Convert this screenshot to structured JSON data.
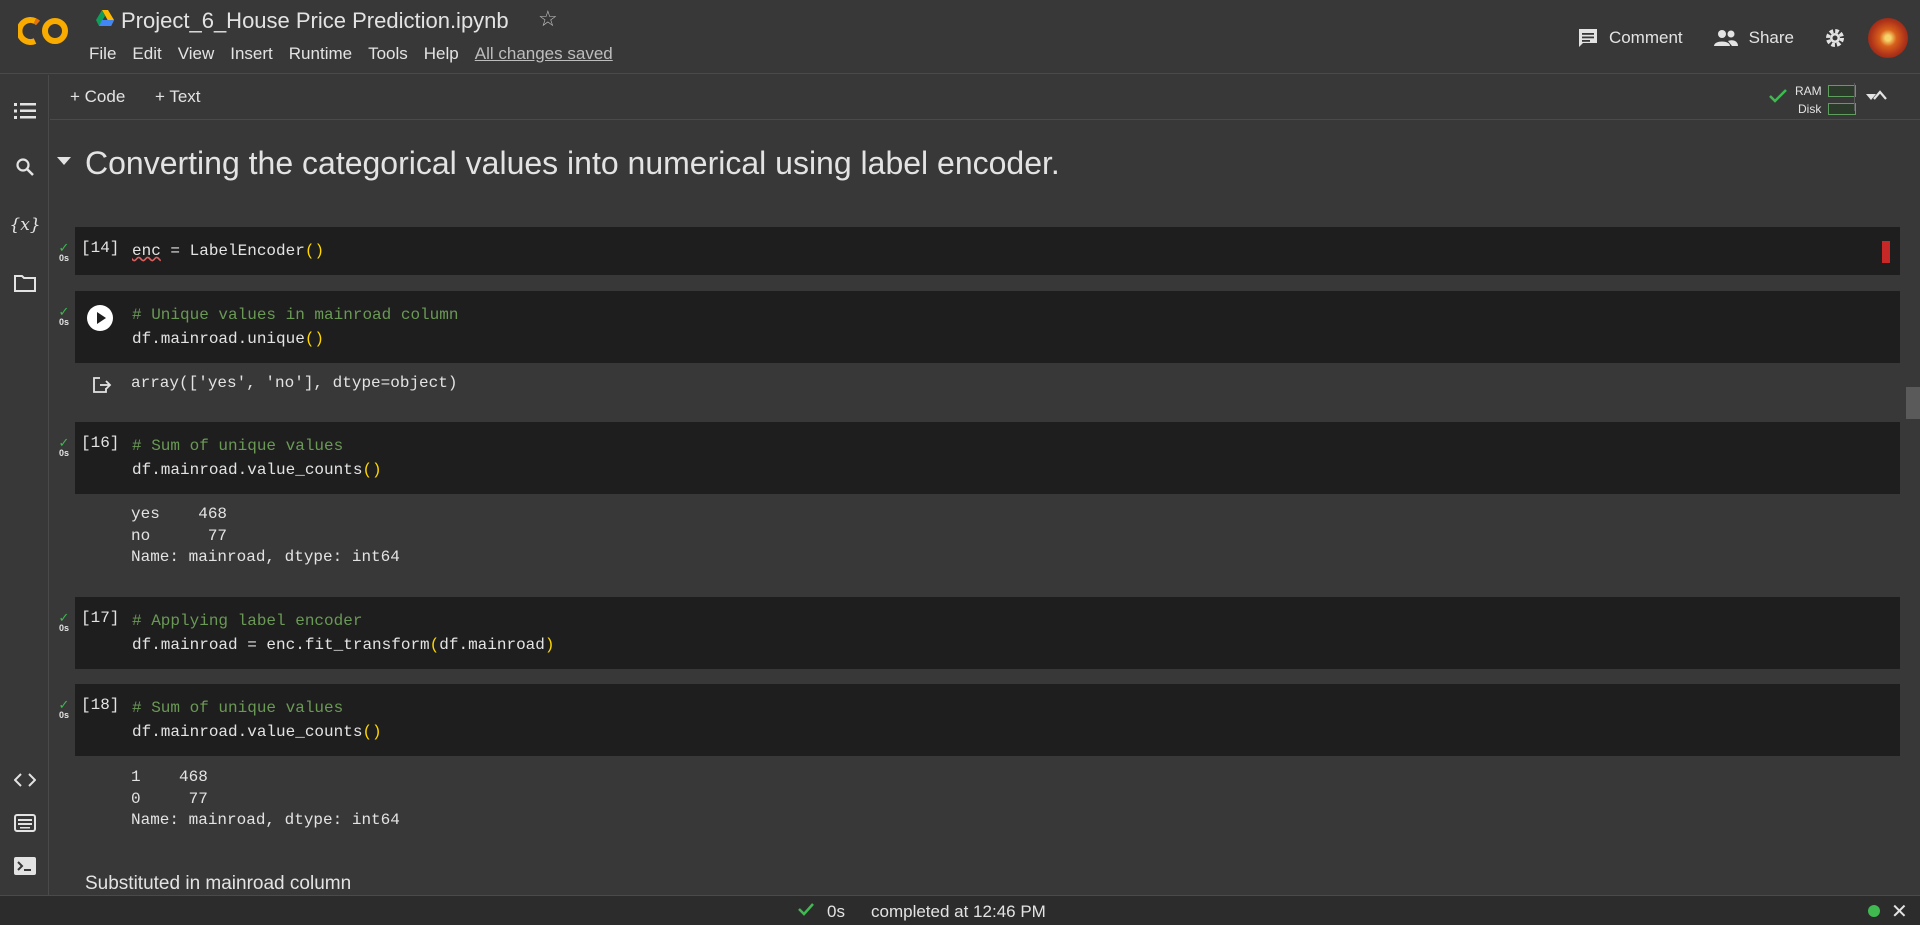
{
  "app": {
    "title": "Project_6_House Price Prediction.ipynb",
    "menu": [
      "File",
      "Edit",
      "View",
      "Insert",
      "Runtime",
      "Tools",
      "Help"
    ],
    "saved_status": "All changes saved",
    "comment_label": "Comment",
    "share_label": "Share"
  },
  "toolbar": {
    "add_code": "+ Code",
    "add_text": "+ Text",
    "ram_label": "RAM",
    "disk_label": "Disk"
  },
  "notebook": {
    "section_title": "Converting the categorical values into numerical using label encoder.",
    "cells": [
      {
        "exec": "[14]",
        "time": "0s",
        "line1_pre": "enc",
        "line1_post": " = LabelEncoder",
        "parens": "()"
      },
      {
        "exec": "",
        "time": "0s",
        "comment": "# Unique values in mainroad column",
        "code": "df.mainroad.unique",
        "parens": "()",
        "output": "array(['yes', 'no'], dtype=object)"
      },
      {
        "exec": "[16]",
        "time": "0s",
        "comment": "# Sum of unique values",
        "code": "df.mainroad.value_counts",
        "parens": "()",
        "output": "yes    468\nno      77\nName: mainroad, dtype: int64"
      },
      {
        "exec": "[17]",
        "time": "0s",
        "comment": "# Applying label encoder",
        "code_pre": "df.mainroad = enc.fit_transform",
        "paren_open": "(",
        "code_arg": "df.mainroad",
        "paren_close": ")"
      },
      {
        "exec": "[18]",
        "time": "0s",
        "comment": "# Sum of unique values",
        "code": "df.mainroad.value_counts",
        "parens": "()",
        "output": "1    468\n0     77\nName: mainroad, dtype: int64"
      }
    ],
    "markdown_text": "Substituted in mainroad column"
  },
  "status": {
    "time": "0s",
    "message": "completed at 12:46 PM"
  },
  "colors": {
    "background": "#383838",
    "cell_bg": "#1e1e1e",
    "comment": "#6a9955",
    "paren": "#ffd700",
    "success": "#3fb950"
  }
}
